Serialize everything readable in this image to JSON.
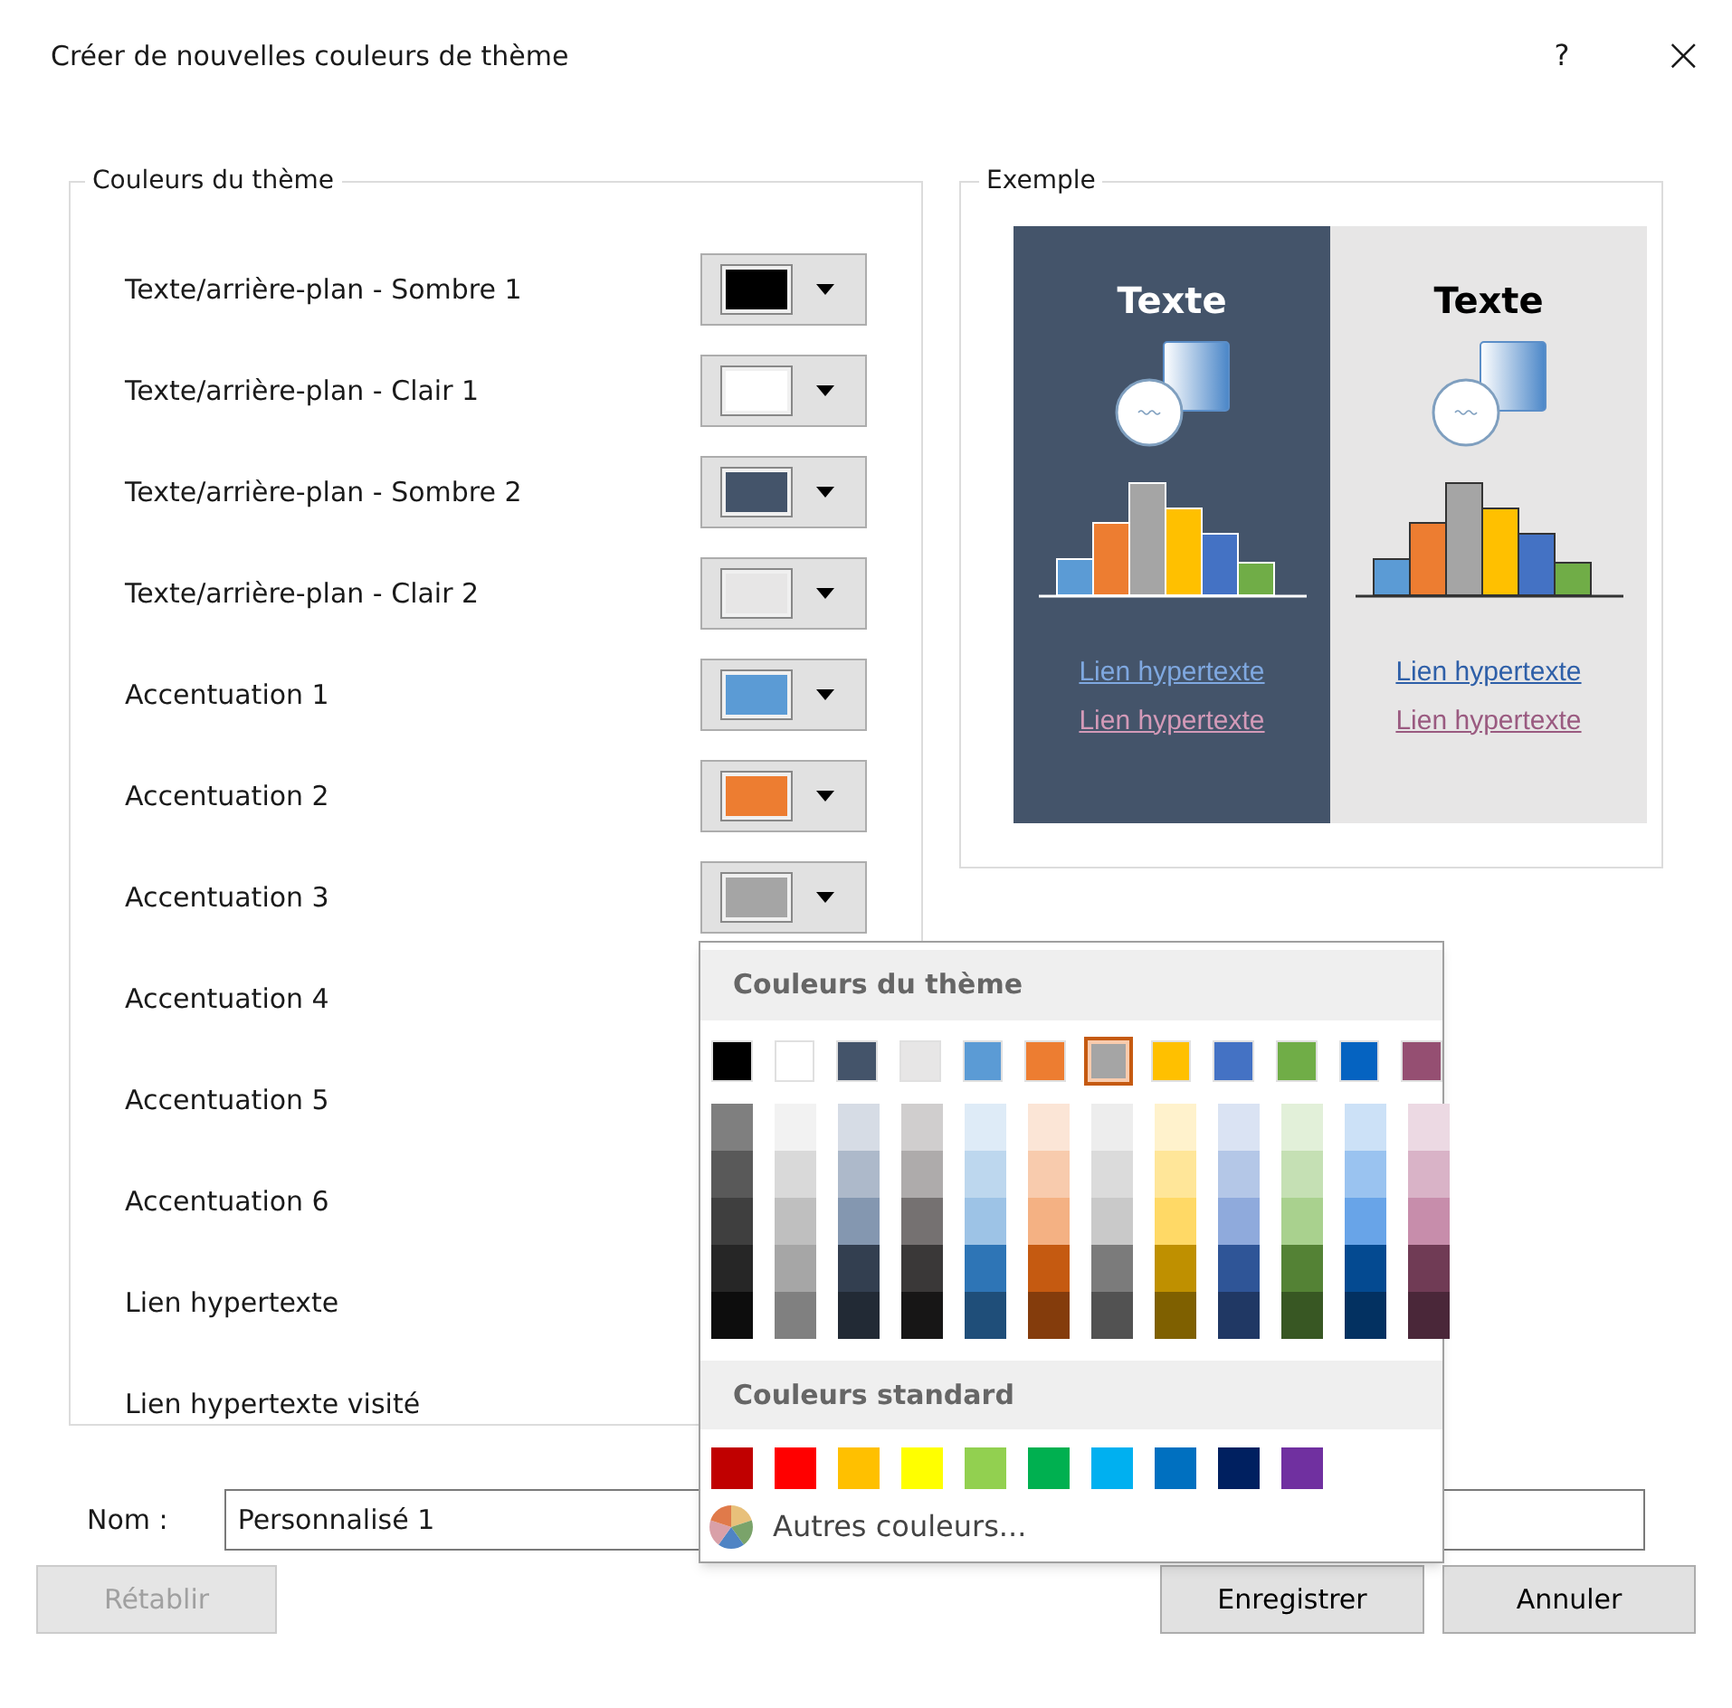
{
  "window": {
    "title": "Créer de nouvelles couleurs de thème",
    "help": "?",
    "close": "×"
  },
  "theme_group": {
    "title": "Couleurs du thème",
    "rows": [
      {
        "label": "Texte/arrière-plan - Sombre 1",
        "color": "#000000"
      },
      {
        "label": "Texte/arrière-plan - Clair 1",
        "color": "#ffffff"
      },
      {
        "label": "Texte/arrière-plan - Sombre 2",
        "color": "#44546a"
      },
      {
        "label": "Texte/arrière-plan - Clair 2",
        "color": "#e7e6e6"
      },
      {
        "label": "Accentuation 1",
        "color": "#5b9bd5"
      },
      {
        "label": "Accentuation 2",
        "color": "#ed7d31"
      },
      {
        "label": "Accentuation 3",
        "color": "#a5a5a5"
      },
      {
        "label": "Accentuation 4"
      },
      {
        "label": "Accentuation 5"
      },
      {
        "label": "Accentuation 6"
      },
      {
        "label": "Lien hypertexte"
      },
      {
        "label": "Lien hypertexte visité"
      }
    ]
  },
  "example": {
    "title": "Exemple",
    "panels": [
      {
        "kind": "dark",
        "heading": "Texte",
        "link": "Lien hypertexte",
        "visited_link": "Lien hypertexte"
      },
      {
        "kind": "light",
        "heading": "Texte",
        "link": "Lien hypertexte",
        "visited_link": "Lien hypertexte"
      }
    ]
  },
  "color_menu": {
    "theme_title": "Couleurs du thème",
    "theme_colors": [
      {
        "color": "#000000",
        "selected": false,
        "shades": [
          {
            "color": "#7f7f7f"
          },
          {
            "color": "#595959"
          },
          {
            "color": "#3f3f3f"
          },
          {
            "color": "#262626"
          },
          {
            "color": "#0d0d0d"
          }
        ]
      },
      {
        "color": "#ffffff",
        "selected": false,
        "shades": [
          {
            "color": "#f2f2f2"
          },
          {
            "color": "#d9d9d9"
          },
          {
            "color": "#bfbfbf"
          },
          {
            "color": "#a6a6a6"
          },
          {
            "color": "#808080"
          }
        ]
      },
      {
        "color": "#44546a",
        "selected": false,
        "shades": [
          {
            "color": "#d6dce5"
          },
          {
            "color": "#adb9ca"
          },
          {
            "color": "#8497b0"
          },
          {
            "color": "#333f50"
          },
          {
            "color": "#222a35"
          }
        ]
      },
      {
        "color": "#e7e6e6",
        "selected": false,
        "shades": [
          {
            "color": "#d0cece"
          },
          {
            "color": "#aeabab"
          },
          {
            "color": "#757171"
          },
          {
            "color": "#3a3838"
          },
          {
            "color": "#171616"
          }
        ]
      },
      {
        "color": "#5b9bd5",
        "selected": false,
        "shades": [
          {
            "color": "#deebf7"
          },
          {
            "color": "#bdd7ee"
          },
          {
            "color": "#9dc3e6"
          },
          {
            "color": "#2e75b6"
          },
          {
            "color": "#1f4e79"
          }
        ]
      },
      {
        "color": "#ed7d31",
        "selected": false,
        "shades": [
          {
            "color": "#fbe5d6"
          },
          {
            "color": "#f8cbad"
          },
          {
            "color": "#f4b183"
          },
          {
            "color": "#c55a11"
          },
          {
            "color": "#843c0c"
          }
        ]
      },
      {
        "color": "#a5a5a5",
        "selected": true,
        "shades": [
          {
            "color": "#ededed"
          },
          {
            "color": "#dbdbdb"
          },
          {
            "color": "#c9c9c9"
          },
          {
            "color": "#7b7b7b"
          },
          {
            "color": "#525252"
          }
        ]
      },
      {
        "color": "#ffc000",
        "selected": false,
        "shades": [
          {
            "color": "#fff2cc"
          },
          {
            "color": "#ffe699"
          },
          {
            "color": "#ffd966"
          },
          {
            "color": "#bf9000"
          },
          {
            "color": "#7f6000"
          }
        ]
      },
      {
        "color": "#4472c4",
        "selected": false,
        "shades": [
          {
            "color": "#dae3f3"
          },
          {
            "color": "#b4c7e7"
          },
          {
            "color": "#8faadc"
          },
          {
            "color": "#2f5597"
          },
          {
            "color": "#203864"
          }
        ]
      },
      {
        "color": "#70ad47",
        "selected": false,
        "shades": [
          {
            "color": "#e2f0d9"
          },
          {
            "color": "#c5e0b4"
          },
          {
            "color": "#a9d18e"
          },
          {
            "color": "#548235"
          },
          {
            "color": "#385723"
          }
        ]
      },
      {
        "color": "#0563c1",
        "selected": false,
        "shades": [
          {
            "color": "#cce1f7"
          },
          {
            "color": "#9ac3f0"
          },
          {
            "color": "#68a4e8"
          },
          {
            "color": "#044a91"
          },
          {
            "color": "#033161"
          }
        ]
      },
      {
        "color": "#954f72",
        "selected": false,
        "shades": [
          {
            "color": "#ecd9e3"
          },
          {
            "color": "#d9b3c7"
          },
          {
            "color": "#c78dab"
          },
          {
            "color": "#703b55"
          },
          {
            "color": "#4a2739"
          }
        ]
      }
    ],
    "standard_title": "Couleurs standard",
    "standard_colors": [
      {
        "color": "#c00000"
      },
      {
        "color": "#ff0000"
      },
      {
        "color": "#ffc000"
      },
      {
        "color": "#ffff00"
      },
      {
        "color": "#92d050"
      },
      {
        "color": "#00b050"
      },
      {
        "color": "#00b0f0"
      },
      {
        "color": "#0070c0"
      },
      {
        "color": "#002060"
      },
      {
        "color": "#7030a0"
      }
    ],
    "more": "Autres couleurs..."
  },
  "name_field": {
    "label": "Nom :",
    "value": "Personnalisé 1"
  },
  "buttons": [
    {
      "label": "Rétablir",
      "disabled": true
    },
    {
      "label": "Enregistrer",
      "disabled": false
    },
    {
      "label": "Annuler",
      "disabled": false
    }
  ]
}
